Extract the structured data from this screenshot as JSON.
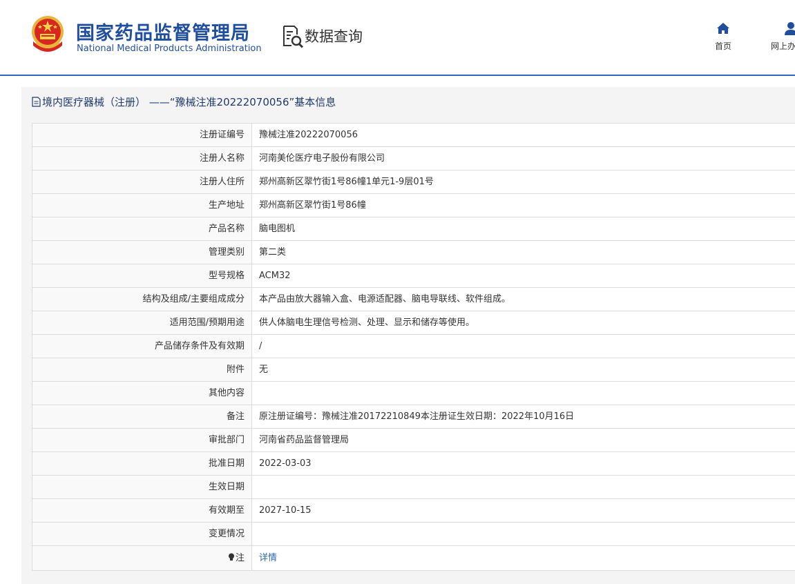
{
  "header": {
    "org_name_cn": "国家药品监督管理局",
    "org_name_en": "National Medical Products Administration",
    "section_title": "数据查询",
    "nav": [
      {
        "label": "首页",
        "icon": "home-icon"
      },
      {
        "label": "网上办事",
        "icon": "user-icon"
      }
    ]
  },
  "panel": {
    "title": "境内医疗器械（注册） ——“豫械注准20222070056”基本信息"
  },
  "table": {
    "rows": [
      {
        "label": "注册证编号",
        "value": "豫械注准20222070056"
      },
      {
        "label": "注册人名称",
        "value": "河南美伦医疗电子股份有限公司"
      },
      {
        "label": "注册人住所",
        "value": "郑州高新区翠竹街1号86幢1单元1-9层01号"
      },
      {
        "label": "生产地址",
        "value": "郑州高新区翠竹街1号86幢"
      },
      {
        "label": "产品名称",
        "value": "脑电图机"
      },
      {
        "label": "管理类别",
        "value": "第二类"
      },
      {
        "label": "型号规格",
        "value": "ACM32"
      },
      {
        "label": "结构及组成/主要组成成分",
        "value": "本产品由放大器输入盒、电源适配器、脑电导联线、软件组成。"
      },
      {
        "label": "适用范围/预期用途",
        "value": "供人体脑电生理信号检测、处理、显示和储存等使用。"
      },
      {
        "label": "产品储存条件及有效期",
        "value": "/"
      },
      {
        "label": "附件",
        "value": "无"
      },
      {
        "label": "其他内容",
        "value": ""
      },
      {
        "label": "备注",
        "value": "原注册证编号：豫械注准20172210849本注册证生效日期：2022年10月16日"
      },
      {
        "label": "审批部门",
        "value": "河南省药品监督管理局"
      },
      {
        "label": "批准日期",
        "value": "2022-03-03"
      },
      {
        "label": "生效日期",
        "value": ""
      },
      {
        "label": "有效期至",
        "value": "2027-10-15"
      },
      {
        "label": "变更情况",
        "value": ""
      }
    ],
    "note_label": "注",
    "note_link": "详情"
  },
  "colors": {
    "brand_blue": "#1f4e9e",
    "header_line": "#2a67b1",
    "link": "#2a67b1"
  }
}
